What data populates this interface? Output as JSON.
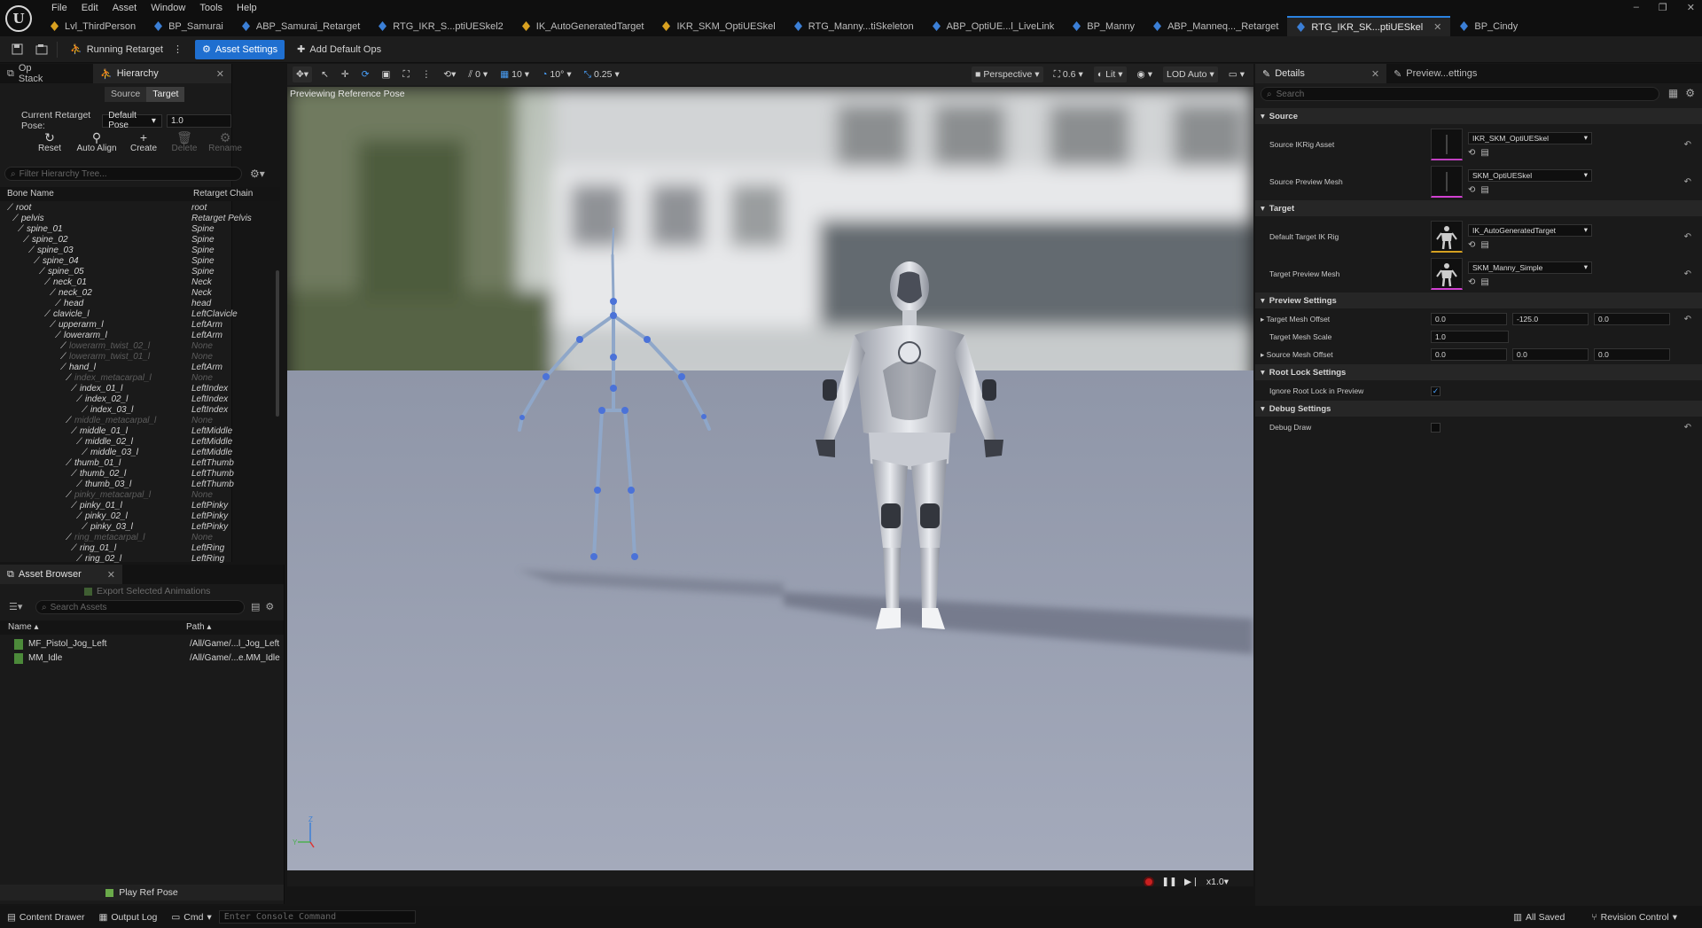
{
  "app": {
    "logo": "U",
    "menus": [
      "File",
      "Edit",
      "Asset",
      "Window",
      "Tools",
      "Help"
    ],
    "tabs": [
      {
        "label": "Lvl_ThirdPerson",
        "color": "#d8a020"
      },
      {
        "label": "BP_Samurai",
        "color": "#3b7fd6"
      },
      {
        "label": "ABP_Samurai_Retarget",
        "color": "#3b7fd6"
      },
      {
        "label": "RTG_IKR_S...ptiUESkel2",
        "color": "#3b7fd6"
      },
      {
        "label": "IK_AutoGeneratedTarget",
        "color": "#d8a020"
      },
      {
        "label": "IKR_SKM_OptiUESkel",
        "color": "#d8a020"
      },
      {
        "label": "RTG_Manny...tiSkeleton",
        "color": "#3b7fd6"
      },
      {
        "label": "ABP_OptiUE...l_LiveLink",
        "color": "#3b7fd6"
      },
      {
        "label": "BP_Manny",
        "color": "#3b7fd6"
      },
      {
        "label": "ABP_Manneq..._Retarget",
        "color": "#3b7fd6"
      },
      {
        "label": "RTG_IKR_SK...ptiUESkel",
        "color": "#3b7fd6",
        "active": true
      },
      {
        "label": "BP_Cindy",
        "color": "#3b7fd6"
      }
    ],
    "window_controls": [
      "–",
      "❐",
      "✕"
    ]
  },
  "toolbar": {
    "running_retarget": "Running Retarget",
    "asset_settings": "Asset Settings",
    "add_default_ops": "Add Default Ops"
  },
  "hierarchy": {
    "tab_opstack": "Op Stack",
    "tab_hierarchy": "Hierarchy",
    "seg_source": "Source",
    "seg_target": "Target",
    "pose_label": "Current Retarget Pose:",
    "pose_value": "Default Pose",
    "pose_blend": "1.0",
    "actions": {
      "reset": "Reset",
      "auto_align": "Auto Align",
      "create": "Create",
      "delete": "Delete",
      "rename": "Rename"
    },
    "filter_placeholder": "Filter Hierarchy Tree...",
    "col_bone": "Bone Name",
    "col_chain": "Retarget Chain",
    "rows": [
      {
        "name": "root",
        "chain": "root",
        "depth": 0
      },
      {
        "name": "pelvis",
        "chain": "Retarget Pelvis",
        "depth": 1
      },
      {
        "name": "spine_01",
        "chain": "Spine",
        "depth": 2
      },
      {
        "name": "spine_02",
        "chain": "Spine",
        "depth": 3
      },
      {
        "name": "spine_03",
        "chain": "Spine",
        "depth": 4
      },
      {
        "name": "spine_04",
        "chain": "Spine",
        "depth": 5
      },
      {
        "name": "spine_05",
        "chain": "Spine",
        "depth": 6
      },
      {
        "name": "neck_01",
        "chain": "Neck",
        "depth": 7
      },
      {
        "name": "neck_02",
        "chain": "Neck",
        "depth": 8
      },
      {
        "name": "head",
        "chain": "head",
        "depth": 9
      },
      {
        "name": "clavicle_l",
        "chain": "LeftClavicle",
        "depth": 7
      },
      {
        "name": "upperarm_l",
        "chain": "LeftArm",
        "depth": 8
      },
      {
        "name": "lowerarm_l",
        "chain": "LeftArm",
        "depth": 9
      },
      {
        "name": "lowerarm_twist_02_l",
        "chain": "None",
        "depth": 10,
        "dim": true
      },
      {
        "name": "lowerarm_twist_01_l",
        "chain": "None",
        "depth": 10,
        "dim": true
      },
      {
        "name": "hand_l",
        "chain": "LeftArm",
        "depth": 10
      },
      {
        "name": "index_metacarpal_l",
        "chain": "None",
        "depth": 11,
        "dim": true
      },
      {
        "name": "index_01_l",
        "chain": "LeftIndex",
        "depth": 12
      },
      {
        "name": "index_02_l",
        "chain": "LeftIndex",
        "depth": 13
      },
      {
        "name": "index_03_l",
        "chain": "LeftIndex",
        "depth": 14
      },
      {
        "name": "middle_metacarpal_l",
        "chain": "None",
        "depth": 11,
        "dim": true
      },
      {
        "name": "middle_01_l",
        "chain": "LeftMiddle",
        "depth": 12
      },
      {
        "name": "middle_02_l",
        "chain": "LeftMiddle",
        "depth": 13
      },
      {
        "name": "middle_03_l",
        "chain": "LeftMiddle",
        "depth": 14
      },
      {
        "name": "thumb_01_l",
        "chain": "LeftThumb",
        "depth": 11
      },
      {
        "name": "thumb_02_l",
        "chain": "LeftThumb",
        "depth": 12
      },
      {
        "name": "thumb_03_l",
        "chain": "LeftThumb",
        "depth": 13
      },
      {
        "name": "pinky_metacarpal_l",
        "chain": "None",
        "depth": 11,
        "dim": true
      },
      {
        "name": "pinky_01_l",
        "chain": "LeftPinky",
        "depth": 12
      },
      {
        "name": "pinky_02_l",
        "chain": "LeftPinky",
        "depth": 13
      },
      {
        "name": "pinky_03_l",
        "chain": "LeftPinky",
        "depth": 14
      },
      {
        "name": "ring_metacarpal_l",
        "chain": "None",
        "depth": 11,
        "dim": true
      },
      {
        "name": "ring_01_l",
        "chain": "LeftRing",
        "depth": 12
      },
      {
        "name": "ring_02_l",
        "chain": "LeftRing",
        "depth": 13
      }
    ]
  },
  "asset_browser": {
    "tab": "Asset Browser",
    "export": "Export Selected Animations",
    "search_placeholder": "Search Assets",
    "col_name": "Name",
    "col_path": "Path",
    "rows": [
      {
        "name": "MF_Pistol_Jog_Left",
        "path": "/All/Game/...l_Jog_Left"
      },
      {
        "name": "MM_Idle",
        "path": "/All/Game/...e.MM_Idle"
      }
    ],
    "play_ref": "Play Ref Pose"
  },
  "viewport": {
    "label": "Previewing Reference Pose",
    "grid_snap": "0",
    "rot_snap_count": "10",
    "rot_snap": "10°",
    "scale_snap": "0.25",
    "perspective": "Perspective",
    "fov": "0.6",
    "lit": "Lit",
    "lod": "LOD Auto",
    "speed": "x1.0",
    "axis_z": "Z",
    "axis_y": "Y"
  },
  "details": {
    "tab_details": "Details",
    "tab_preview": "Preview...ettings",
    "search_placeholder": "Search",
    "cat_source": "Source",
    "source_ik_label": "Source IKRig Asset",
    "source_ik_value": "IKR_SKM_OptiUESkel",
    "source_mesh_label": "Source Preview Mesh",
    "source_mesh_value": "SKM_OptiUESkel",
    "cat_target": "Target",
    "target_ik_label": "Default Target IK Rig",
    "target_ik_value": "IK_AutoGeneratedTarget",
    "target_mesh_label": "Target Preview Mesh",
    "target_mesh_value": "SKM_Manny_Simple",
    "cat_preview": "Preview Settings",
    "target_offset_label": "Target Mesh Offset",
    "target_offset": [
      "0.0",
      "-125.0",
      "0.0"
    ],
    "target_scale_label": "Target Mesh Scale",
    "target_scale": "1.0",
    "source_offset_label": "Source Mesh Offset",
    "source_offset": [
      "0.0",
      "0.0",
      "0.0"
    ],
    "cat_root": "Root Lock Settings",
    "ignore_root_label": "Ignore Root Lock in Preview",
    "ignore_root_checked": true,
    "cat_debug": "Debug Settings",
    "debug_draw_label": "Debug Draw",
    "debug_draw_checked": false
  },
  "status": {
    "content_drawer": "Content Drawer",
    "output_log": "Output Log",
    "cmd": "Cmd",
    "console_placeholder": "Enter Console Command",
    "all_saved": "All Saved",
    "revision": "Revision Control"
  },
  "colors": {
    "accent": "#1f6fd0",
    "active_tab_line": "#2a82e0",
    "record": "#c82020"
  }
}
